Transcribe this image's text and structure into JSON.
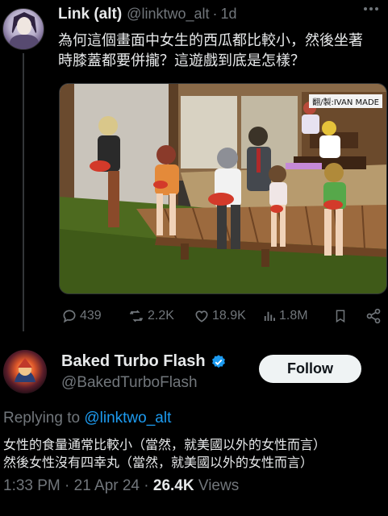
{
  "tweet1": {
    "display_name": "Link (alt)",
    "handle": "@linktwo_alt",
    "separator": "·",
    "time": "1d",
    "text_line1": "為何這個畫面中女生的西瓜都比較小，然後坐著",
    "text_line2": "時膝蓋都要併攏？這遊戲到底是怎樣？",
    "watermark": "翻/製:IVAN MADE",
    "stats": {
      "replies": "439",
      "retweets": "2.2K",
      "likes": "18.9K",
      "views": "1.8M"
    },
    "icons": [
      "more-icon",
      "reply-icon",
      "retweet-icon",
      "like-icon",
      "views-icon",
      "bookmark-icon",
      "share-icon"
    ]
  },
  "tweet2": {
    "display_name": "Baked Turbo Flash",
    "handle": "@BakedTurboFlash",
    "follow_label": "Follow",
    "replying_prefix": "Replying to ",
    "replying_handle": "@linktwo_alt",
    "text_line1": "女性的食量通常比較小（當然，就美國以外的女性而言）",
    "text_line2": "然後女性沒有四幸丸（當然，就美國以外的女性而言）",
    "meta_time": "1:33 PM",
    "meta_sep": " · ",
    "meta_date": "21 Apr 24",
    "meta_sep2": " · ",
    "views_count": "26.4K",
    "views_label": " Views"
  },
  "colors": {
    "background": "#000000",
    "text": "#e7e9ea",
    "secondary": "#71767b",
    "accent": "#1d9bf0",
    "follow_bg": "#eff3f4"
  }
}
